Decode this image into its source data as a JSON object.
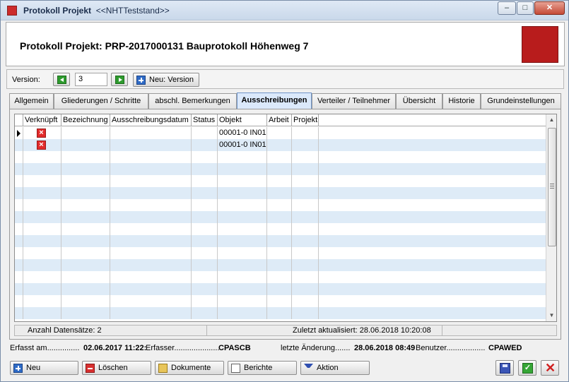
{
  "window": {
    "title_bold": "Protokoll Projekt",
    "title_rest": "<<NHTTeststand>>",
    "minimize": "–",
    "maximize": "□",
    "close": "✕"
  },
  "header": {
    "title": "Protokoll Projekt: PRP-2017000131 Bauprotokoll Höhenweg 7",
    "accent_color": "#b81c1c"
  },
  "version": {
    "label": "Version:",
    "value": "3",
    "new_label": "Neu: Version"
  },
  "tabs": [
    {
      "label": "Allgemein"
    },
    {
      "label": "Gliederungen / Schritte"
    },
    {
      "label": "abschl. Bemerkungen"
    },
    {
      "label": "Ausschreibungen"
    },
    {
      "label": "Verteiler / Teilnehmer"
    },
    {
      "label": "Übersicht"
    },
    {
      "label": "Historie"
    },
    {
      "label": "Grundeinstellungen"
    }
  ],
  "active_tab": "Ausschreibungen",
  "grid": {
    "columns": [
      "Verknüpft",
      "Bezeichnung",
      "Ausschreibungsdatum",
      "Status",
      "Objekt",
      "Arbeit",
      "Projekt"
    ],
    "rows": [
      {
        "linked_icon": "x-icon",
        "objekt": "00001-0 IN01"
      },
      {
        "linked_icon": "x-icon",
        "objekt": "00001-0 IN01"
      }
    ],
    "row_alt_color": "#deebf7"
  },
  "status": {
    "count": "Anzahl Datensätze: 2",
    "updated": "Zuletzt aktualisiert: 28.06.2018 10:20:08"
  },
  "info": {
    "erfasst_label": "Erfasst am...............",
    "erfasst_value": "02.06.2017 11:22:",
    "erfasser_label": "Erfasser.....................",
    "erfasser_value": "CPASCB",
    "aenderung_label": "letzte Änderung.......",
    "aenderung_value": "28.06.2018 08:49",
    "benutzer_label": "Benutzer..................",
    "benutzer_value": "CPAWED"
  },
  "buttons": {
    "neu": "Neu",
    "loeschen": "Löschen",
    "dokumente": "Dokumente",
    "berichte": "Berichte",
    "aktion": "Aktion"
  }
}
